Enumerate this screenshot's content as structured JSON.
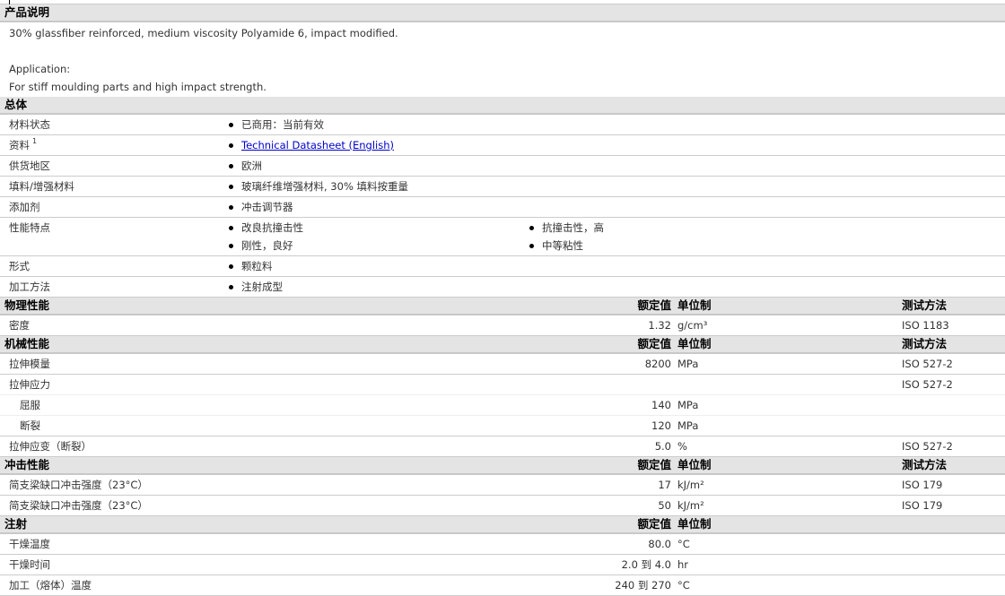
{
  "description": {
    "title": "产品说明",
    "line1": "30% glassfiber reinforced, medium viscosity Polyamide 6, impact modified.",
    "line2": "Application:",
    "line3": "For stiff moulding parts and high impact strength."
  },
  "general": {
    "title": "总体",
    "rows": [
      {
        "label": "材料状态",
        "value": "已商用：当前有效"
      },
      {
        "label": "资料",
        "sup": "1",
        "value": "Technical Datasheet (English)"
      },
      {
        "label": "供货地区",
        "value": "欧洲"
      },
      {
        "label": "填料/增强材料",
        "value": "玻璃纤维增强材料, 30% 填料按重量"
      },
      {
        "label": "添加剂",
        "value": "冲击调节器"
      },
      {
        "label": "性能特点",
        "values": [
          "改良抗撞击性",
          "抗撞击性，高",
          "刚性，良好",
          "中等粘性"
        ]
      },
      {
        "label": "形式",
        "value": "颗粒料"
      },
      {
        "label": "加工方法",
        "value": "注射成型"
      }
    ]
  },
  "headers": {
    "value": "额定值",
    "unit": "单位制",
    "method": "测试方法"
  },
  "physical": {
    "title": "物理性能",
    "rows": [
      {
        "label": "密度",
        "value": "1.32",
        "unit": "g/cm³",
        "method": "ISO 1183"
      }
    ]
  },
  "mechanical": {
    "title": "机械性能",
    "rows": [
      {
        "label": "拉伸模量",
        "value": "8200",
        "unit": "MPa",
        "method": "ISO 527-2"
      },
      {
        "label": "拉伸应力",
        "method": "ISO 527-2"
      },
      {
        "label": "屈服",
        "value": "140",
        "unit": "MPa"
      },
      {
        "label": "断裂",
        "value": "120",
        "unit": "MPa"
      },
      {
        "label": "拉伸应变（断裂）",
        "value": "5.0",
        "unit": "%",
        "method": "ISO 527-2"
      }
    ]
  },
  "impact": {
    "title": "冲击性能",
    "rows": [
      {
        "label": "简支梁缺口冲击强度（23°C）",
        "value": "17",
        "unit": "kJ/m²",
        "method": "ISO 179"
      },
      {
        "label": "简支梁缺口冲击强度（23°C）",
        "value": "50",
        "unit": "kJ/m²",
        "method": "ISO 179"
      }
    ]
  },
  "injection": {
    "title": "注射",
    "rows": [
      {
        "label": "干燥温度",
        "value": "80.0",
        "unit": "°C"
      },
      {
        "label": "干燥时间",
        "value": "2.0 到  4.0",
        "unit": "hr"
      },
      {
        "label": "加工（熔体）温度",
        "value": "240 到  270",
        "unit": "°C"
      }
    ]
  }
}
